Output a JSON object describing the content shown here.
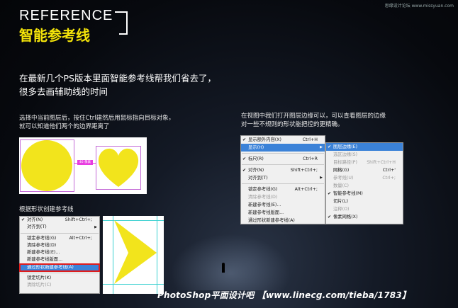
{
  "watermark": "思缘设计论坛 www.missyuan.com",
  "header": {
    "label": "REFERENCE",
    "title": "智能参考线"
  },
  "intro": {
    "line1": "在最新几个PS版本里面智能参考线帮我们省去了，",
    "line2": "很多去画辅助线的时间"
  },
  "desc_left": {
    "line1": "选择中当前图层后，按住Ctrl建然后用鼠标指向目标对象，",
    "line2": "就可以知道他们两个的边界距离了"
  },
  "desc_right": {
    "line1": "在视图中我们打开图层边缘可以，可以查看图层的边缘",
    "line2": "对一些不规则的形状能把控的更精确。"
  },
  "desc_shape": "根据形状创建参考线",
  "measure_label": "46 像素",
  "view_menu": [
    {
      "label": "显示额外内容(X)",
      "shortcut": "Ctrl+H",
      "check": true
    },
    {
      "label": "显示(H)",
      "shortcut": "",
      "arrow": true,
      "highlight": true
    },
    {
      "sep": true
    },
    {
      "label": "标尺(R)",
      "shortcut": "Ctrl+R",
      "check": true
    },
    {
      "sep": true
    },
    {
      "label": "对齐(N)",
      "shortcut": "Shift+Ctrl+;",
      "check": true
    },
    {
      "label": "对齐到(T)",
      "shortcut": "",
      "arrow": true
    },
    {
      "sep": true
    },
    {
      "label": "锁定参考线(G)",
      "shortcut": "Alt+Ctrl+;"
    },
    {
      "label": "清除参考线(D)",
      "shortcut": "",
      "disabled": true
    },
    {
      "label": "新建参考线(E)...",
      "shortcut": ""
    },
    {
      "label": "新建参考线版面...",
      "shortcut": ""
    },
    {
      "label": "通过形状新建参考线(A)",
      "shortcut": ""
    }
  ],
  "show_submenu": [
    {
      "label": "图层边缘(E)",
      "shortcut": "",
      "check": true,
      "highlight": true
    },
    {
      "label": "选区边缘(S)",
      "shortcut": "",
      "disabled": true
    },
    {
      "label": "目标路径(P)",
      "shortcut": "Shift+Ctrl+H",
      "disabled": true
    },
    {
      "label": "网格(G)",
      "shortcut": "Ctrl+'"
    },
    {
      "label": "参考线(U)",
      "shortcut": "Ctrl+;",
      "disabled": true
    },
    {
      "label": "数量(C)",
      "shortcut": "",
      "disabled": true
    },
    {
      "label": "智能参考线(M)",
      "shortcut": "",
      "check": true
    },
    {
      "label": "切片(L)",
      "shortcut": ""
    },
    {
      "label": "注释(O)",
      "shortcut": "",
      "disabled": true
    },
    {
      "label": "像素网格(X)",
      "shortcut": "",
      "check": true
    }
  ],
  "shape_menu": [
    {
      "label": "对齐(N)",
      "shortcut": "Shift+Ctrl+;",
      "check": true
    },
    {
      "label": "对齐到(T)",
      "shortcut": "",
      "arrow": true
    },
    {
      "sep": true
    },
    {
      "label": "锁定参考线(G)",
      "shortcut": "Alt+Ctrl+;"
    },
    {
      "label": "清除参考线(D)",
      "shortcut": ""
    },
    {
      "label": "新建参考线(E)...",
      "shortcut": ""
    },
    {
      "label": "新建参考线版面...",
      "shortcut": ""
    },
    {
      "label": "通过形状新建参考线(A)",
      "shortcut": "",
      "highlight": true,
      "boxed": true
    },
    {
      "sep": true
    },
    {
      "label": "锁定切片(K)",
      "shortcut": ""
    },
    {
      "label": "清除切片(C)",
      "shortcut": "",
      "disabled": true
    }
  ],
  "footer": "PhotoShop平面设计吧 【www.linecg.com/tieba/1783】",
  "colors": {
    "accent_yellow": "#f4e40a",
    "menu_highlight": "#3b82d8",
    "guide_cyan": "#3bd0d0",
    "measure_magenta": "#e83ce0"
  }
}
